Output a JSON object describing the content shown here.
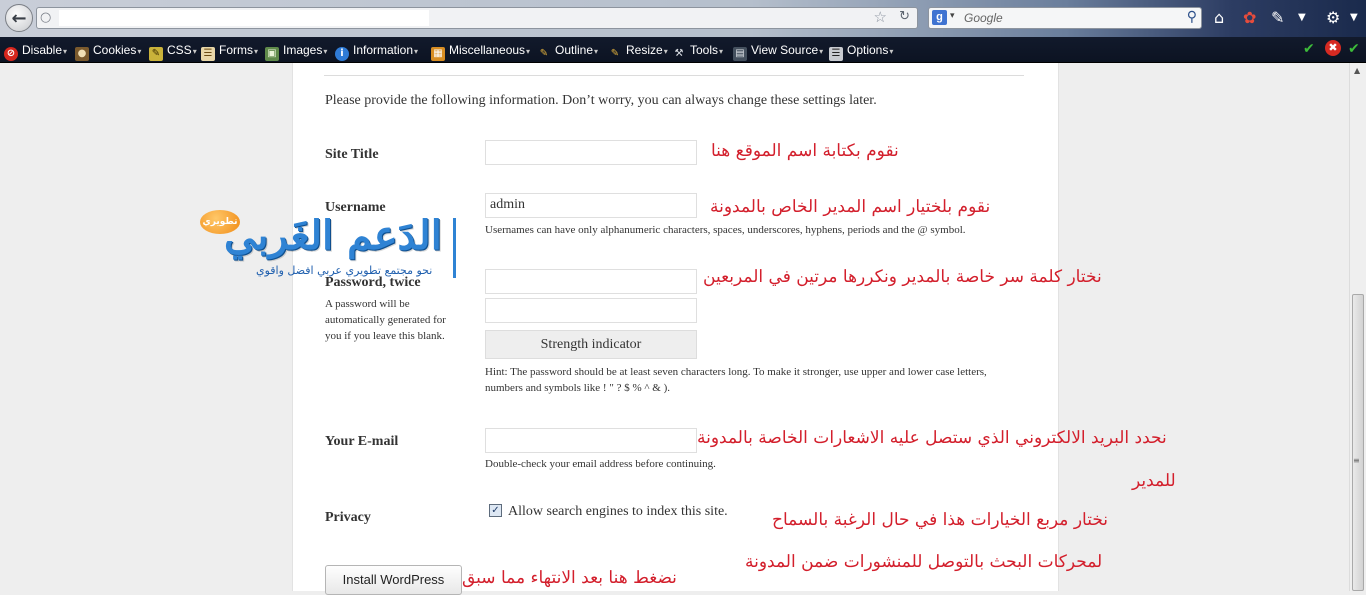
{
  "browser": {
    "search_placeholder": "Google",
    "toolbar_items": [
      {
        "label": "Disable",
        "icon": "no-entry-icon",
        "color": "#d7261d"
      },
      {
        "label": "Cookies",
        "icon": "cookies-icon",
        "color": "#8a6a3a"
      },
      {
        "label": "CSS",
        "icon": "css-icon",
        "color": "#c9b23a"
      },
      {
        "label": "Forms",
        "icon": "forms-icon",
        "color": "#d0b07a"
      },
      {
        "label": "Images",
        "icon": "images-icon",
        "color": "#5f8a4a"
      },
      {
        "label": "Information",
        "icon": "information-icon",
        "color": "#2f7bd6"
      },
      {
        "label": "Miscellaneous",
        "icon": "miscellaneous-icon",
        "color": "#d98e23"
      },
      {
        "label": "Outline",
        "icon": "outline-icon",
        "color": "#e2b13c"
      },
      {
        "label": "Resize",
        "icon": "resize-icon",
        "color": "#e2b13c"
      },
      {
        "label": "Tools",
        "icon": "tools-icon",
        "color": "#9aa3ad"
      },
      {
        "label": "View Source",
        "icon": "view-source-icon",
        "color": "#9aa3ad"
      },
      {
        "label": "Options",
        "icon": "options-icon",
        "color": "#c8cbd0"
      }
    ]
  },
  "form": {
    "intro": "Please provide the following information. Don’t worry, you can always change these settings later.",
    "site_title_label": "Site Title",
    "site_title_value": "",
    "username_label": "Username",
    "username_value": "admin",
    "username_hint": "Usernames can have only alphanumeric characters, spaces, underscores, hyphens, periods and the @ symbol.",
    "password_label": "Password, twice",
    "password_note": [
      "A password will be",
      "automatically generated for",
      "you if you leave this blank."
    ],
    "strength_label": "Strength indicator",
    "password_hint": [
      "Hint: The password should be at least seven characters long. To make it stronger, use upper and lower case letters,",
      "numbers and symbols like ! \" ? $ % ^ & )."
    ],
    "email_label": "Your E-mail",
    "email_hint": "Double-check your email address before continuing.",
    "privacy_label": "Privacy",
    "privacy_checkbox_label": "Allow search engines to index this site.",
    "privacy_checked": true,
    "install_button": "Install WordPress"
  },
  "annotations": {
    "site_title": "نقوم بكتابة اسم الموقع هنا",
    "username": "نقوم بلختيار اسم المدير الخاص بالمدونة",
    "password": "نختار كلمة سر خاصة بالمدير ونكررها مرتين في المربعين",
    "email_line1": "نحدد البريد الالكتروني الذي ستصل عليه الاشعارات الخاصة بالمدونة",
    "email_line2": "للمدير",
    "privacy_line1": "نختار مربع الخيارات هذا في حال الرغبة بالسماح",
    "privacy_line2": "لمحركات البحث بالتوصل للمنشورات ضمن المدونة",
    "install": "نضغط هنا بعد الانتهاء مما سبق"
  },
  "logo": {
    "badge": "تطويري",
    "title": "الدَعم الغَربي",
    "tagline": "نحو مجتمع تطويري عربي افضل واقوي"
  },
  "colors": {
    "annotation": "#d31f2c",
    "logo_blue": "#2f83d4"
  }
}
